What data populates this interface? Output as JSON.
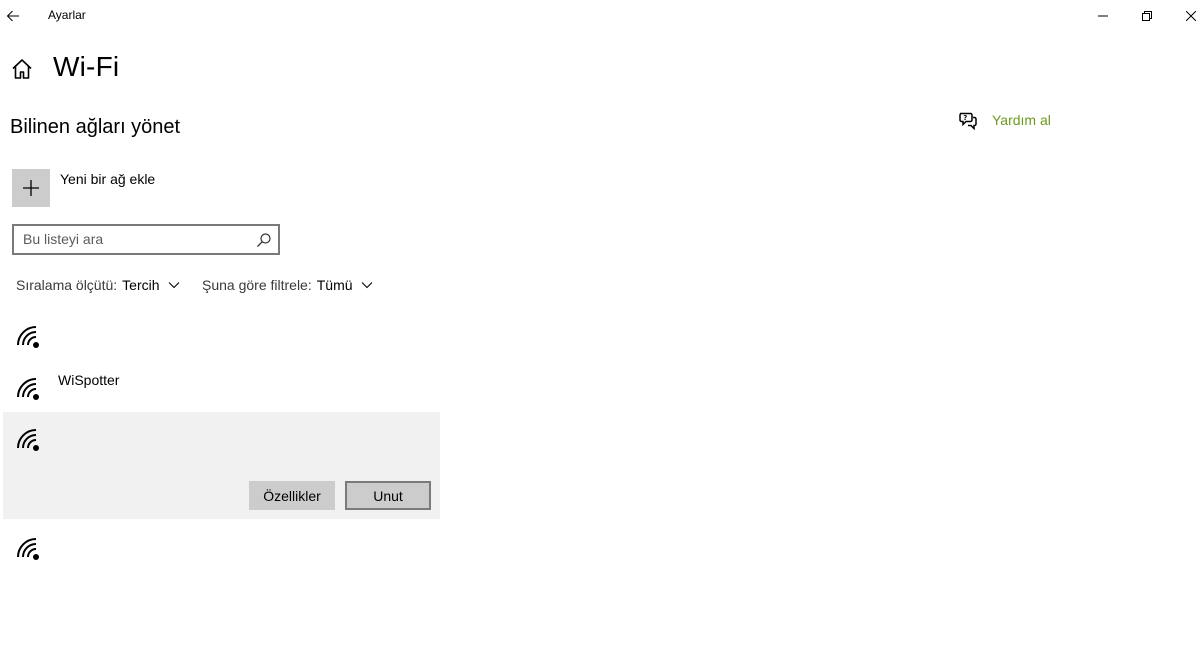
{
  "window": {
    "title": "Ayarlar"
  },
  "header": {
    "title": "Wi-Fi",
    "section": "Bilinen ağları yönet"
  },
  "help": {
    "label": "Yardım al",
    "color": "#6c9a1d"
  },
  "add_network": {
    "label": "Yeni bir ağ ekle"
  },
  "search": {
    "placeholder": "Bu listeyi ara",
    "value": ""
  },
  "sort": {
    "label": "Sıralama ölçütü:",
    "value": "Tercih"
  },
  "filter": {
    "label": "Şuna göre filtrele:",
    "value": "Tümü"
  },
  "networks": [
    {
      "name": ""
    },
    {
      "name": "WiSpotter"
    },
    {
      "name": "",
      "selected": true
    },
    {
      "name": ""
    }
  ],
  "selected_actions": {
    "properties_label": "Özellikler",
    "forget_label": "Unut"
  },
  "icons": {
    "back": "back-arrow-icon",
    "home": "home-icon",
    "help": "chat-help-icon",
    "add": "plus-icon",
    "search": "search-icon",
    "chevron": "chevron-down-icon",
    "wifi": "wifi-signal-icon"
  }
}
